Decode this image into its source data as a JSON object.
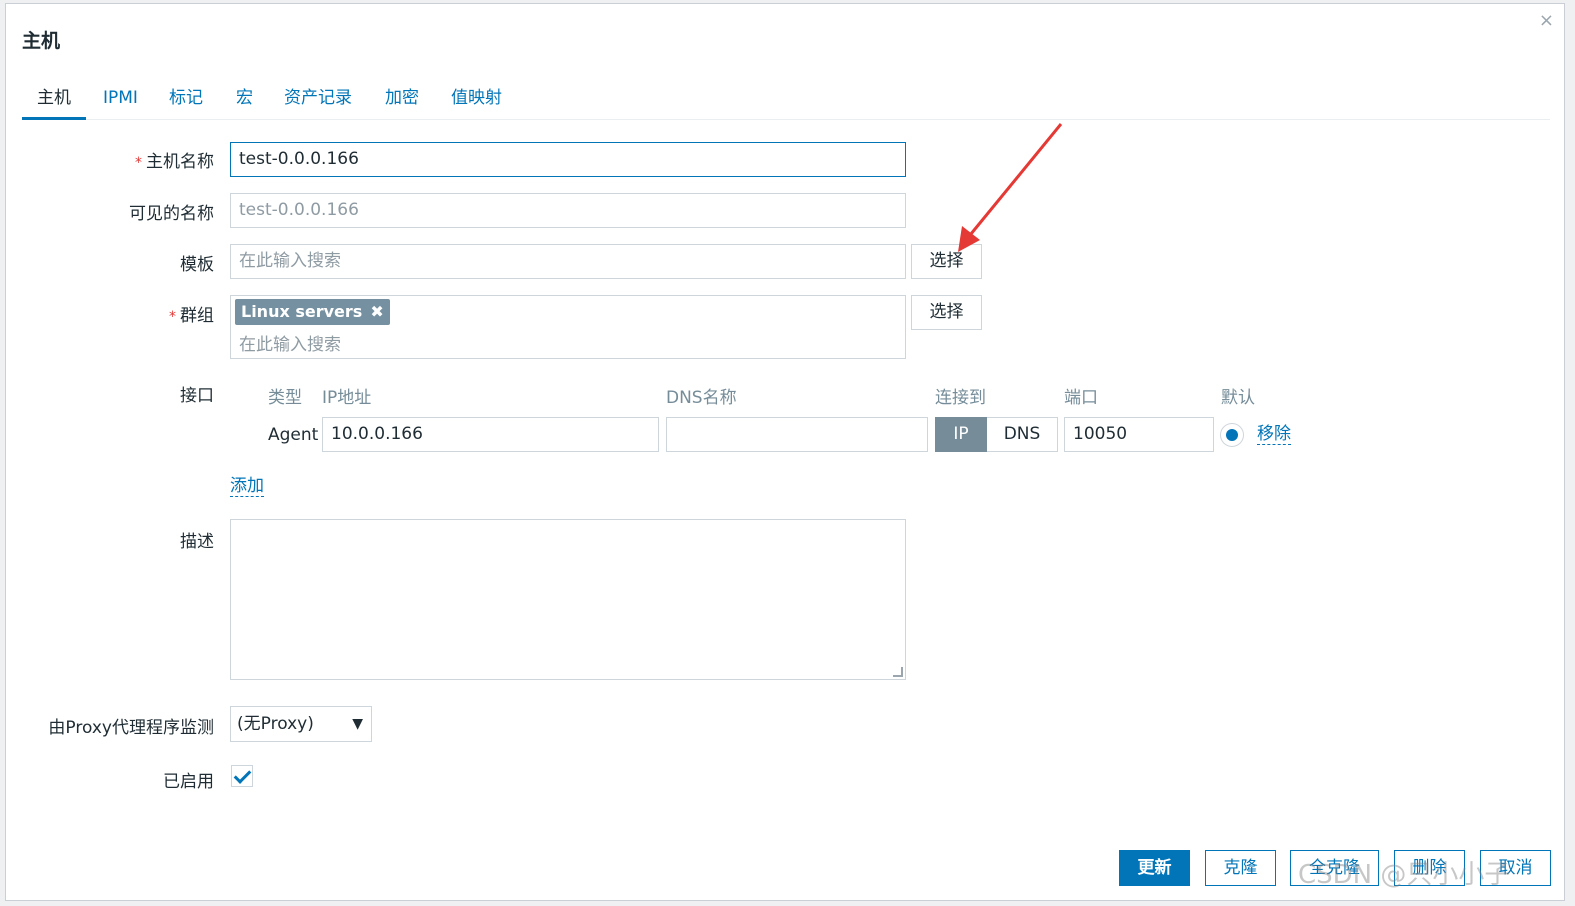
{
  "dialog": {
    "title": "主机",
    "close_label": "×"
  },
  "tabs": [
    {
      "label": "主机",
      "active": true
    },
    {
      "label": "IPMI"
    },
    {
      "label": "标记"
    },
    {
      "label": "宏"
    },
    {
      "label": "资产记录"
    },
    {
      "label": "加密"
    },
    {
      "label": "值映射"
    }
  ],
  "form": {
    "host_name": {
      "label": "主机名称",
      "required_mark": "*",
      "value": "test-0.0.0.166"
    },
    "visible_name": {
      "label": "可见的名称",
      "placeholder": "test-0.0.0.166"
    },
    "templates": {
      "label": "模板",
      "placeholder": "在此输入搜索",
      "select_label": "选择"
    },
    "groups": {
      "label": "群组",
      "required_mark": "*",
      "chips": [
        "Linux servers"
      ],
      "chip_remove": "✖",
      "placeholder": "在此输入搜索",
      "select_label": "选择"
    },
    "interfaces": {
      "label": "接口",
      "headers": {
        "type": "类型",
        "ip": "IP地址",
        "dns": "DNS名称",
        "connect_to": "连接到",
        "port": "端口",
        "default": "默认"
      },
      "rows": [
        {
          "type": "Agent",
          "ip": "10.0.0.166",
          "dns": "",
          "connect_ip": "IP",
          "connect_dns": "DNS",
          "port": "10050",
          "remove": "移除"
        }
      ],
      "add_label": "添加"
    },
    "description": {
      "label": "描述",
      "value": ""
    },
    "proxy": {
      "label": "由Proxy代理程序监测",
      "selected": "(无Proxy)"
    },
    "enabled": {
      "label": "已启用",
      "checked": true
    }
  },
  "footer": {
    "update": "更新",
    "clone": "克隆",
    "full_clone": "全克隆",
    "delete": "删除",
    "cancel": "取消"
  },
  "watermark": "CSDN @只小小子",
  "colors": {
    "accent": "#0275b8",
    "required": "#e33734",
    "annotation_arrow": "#e53935"
  }
}
